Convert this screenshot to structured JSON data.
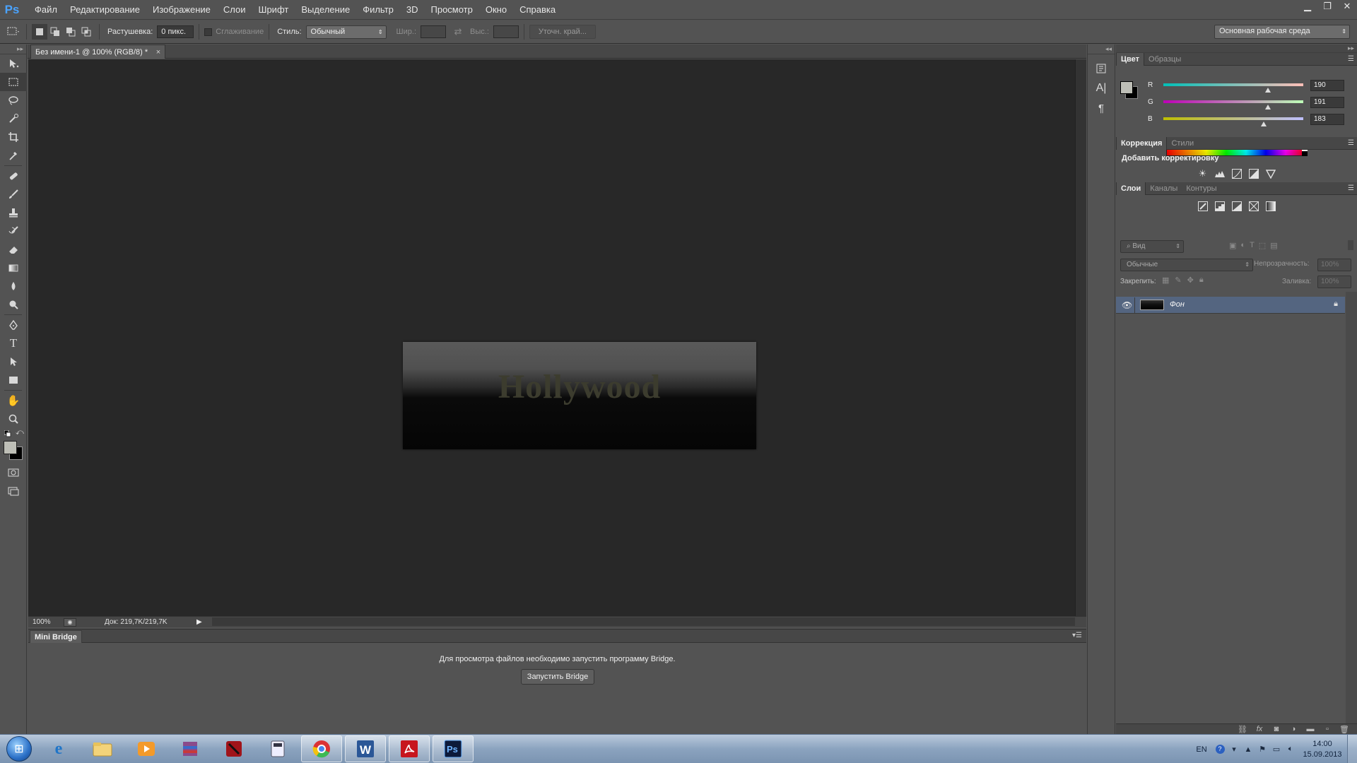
{
  "app": {
    "logo": "Ps",
    "menu": [
      "Файл",
      "Редактирование",
      "Изображение",
      "Слои",
      "Шрифт",
      "Выделение",
      "Фильтр",
      "3D",
      "Просмотр",
      "Окно",
      "Справка"
    ],
    "window_controls": [
      "minimize-icon",
      "restore-icon",
      "close-icon"
    ]
  },
  "options_bar": {
    "feather_label": "Растушевка:",
    "feather_value": "0 пикс.",
    "antialias_label": "Сглаживание",
    "style_label": "Стиль:",
    "style_value": "Обычный",
    "width_label": "Шир.:",
    "height_label": "Выс.:",
    "refine_edge": "Уточн. край...",
    "workspace": "Основная рабочая среда"
  },
  "document": {
    "tab_title": "Без имени-1 @ 100% (RGB/8) *",
    "image_text": "Hollywood",
    "zoom": "100%",
    "doc_info": "Док: 219,7K/219,7K"
  },
  "mini_bridge": {
    "tab": "Mini Bridge",
    "message": "Для просмотра файлов необходимо запустить программу Bridge.",
    "button": "Запустить Bridge"
  },
  "color_panel": {
    "tabs": [
      "Цвет",
      "Образцы"
    ],
    "channels": [
      {
        "label": "R",
        "value": "190",
        "level": 0.745
      },
      {
        "label": "G",
        "value": "191",
        "level": 0.749
      },
      {
        "label": "B",
        "value": "183",
        "level": 0.718
      }
    ],
    "fg_color": "#bebfb7",
    "bg_color": "#000000"
  },
  "adjust_panel": {
    "tabs": [
      "Коррекция",
      "Стили"
    ],
    "title": "Добавить корректировку"
  },
  "layers_panel": {
    "tabs": [
      "Слои",
      "Каналы",
      "Контуры"
    ],
    "filter_kind": "Вид",
    "blend_mode": "Обычные",
    "opacity_label": "Непрозрачность:",
    "opacity_value": "100%",
    "lock_label": "Закрепить:",
    "fill_label": "Заливка:",
    "fill_value": "100%",
    "layers": [
      {
        "name": "Фон",
        "visible": true,
        "locked": true
      }
    ]
  },
  "taskbar": {
    "apps": [
      "internet-explorer-icon",
      "file-explorer-icon",
      "media-player-icon",
      "winrar-icon",
      "dota-icon",
      "calculator-icon",
      "chrome-icon",
      "word-icon",
      "acrobat-icon",
      "photoshop-icon"
    ],
    "lang": "EN",
    "time": "14:00",
    "date": "15.09.2013"
  }
}
